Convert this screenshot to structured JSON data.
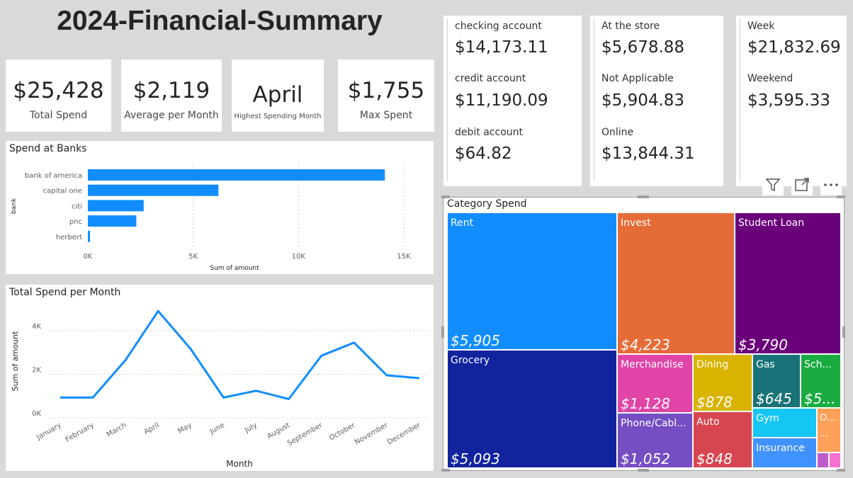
{
  "page_title": "2024-Financial-Summary",
  "kpis": [
    {
      "value": "$25,428",
      "label": "Total Spend"
    },
    {
      "value": "$2,119",
      "label": "Average per Month"
    },
    {
      "value": "April",
      "label": "Highest Spending Month"
    },
    {
      "value": "$1,755",
      "label": "Max Spent"
    }
  ],
  "multirow_cards": [
    {
      "rows": [
        {
          "label": "checking account",
          "value": "$14,173.11"
        },
        {
          "label": "credit account",
          "value": "$11,190.09"
        },
        {
          "label": "debit account",
          "value": "$64.82"
        }
      ]
    },
    {
      "rows": [
        {
          "label": "At the store",
          "value": "$5,678.88"
        },
        {
          "label": "Not Applicable",
          "value": "$5,904.83"
        },
        {
          "label": "Online",
          "value": "$13,844.31"
        }
      ]
    },
    {
      "rows": [
        {
          "label": "Week",
          "value": "$21,832.69"
        },
        {
          "label": "Weekend",
          "value": "$3,595.33"
        }
      ]
    }
  ],
  "visual_header": {
    "icons": [
      "filter-icon",
      "focus-mode-icon",
      "more-options-icon"
    ]
  },
  "chart_data": [
    {
      "type": "bar",
      "orientation": "horizontal",
      "title": "Spend at Banks",
      "xlabel": "Sum of amount",
      "ylabel": "bank",
      "categories": [
        "bank of america",
        "capital one",
        "citi",
        "pnc",
        "herbert"
      ],
      "values": [
        14100,
        6200,
        2650,
        2300,
        100
      ],
      "xlim": [
        0,
        15000
      ],
      "x_ticks": [
        0,
        5000,
        10000,
        15000
      ],
      "x_tick_labels": [
        "0K",
        "5K",
        "10K",
        "15K"
      ],
      "grid": true,
      "color": "#118DFF"
    },
    {
      "type": "line",
      "title": "Total Spend per Month",
      "xlabel": "Month",
      "ylabel": "Sum of amount",
      "categories": [
        "January",
        "February",
        "March",
        "April",
        "May",
        "June",
        "July",
        "August",
        "September",
        "October",
        "November",
        "December"
      ],
      "values": [
        930,
        930,
        2650,
        4900,
        3150,
        930,
        1240,
        860,
        2850,
        3450,
        1950,
        1820
      ],
      "ylim": [
        0,
        5200
      ],
      "y_ticks": [
        0,
        2000,
        4000
      ],
      "y_tick_labels": [
        "0K",
        "2K",
        "4K"
      ],
      "grid": true,
      "color": "#118DFF"
    },
    {
      "type": "treemap",
      "title": "Category Spend",
      "items": [
        {
          "label": "Rent",
          "value_label": "$5,905",
          "value": 5905,
          "color": "#118DFF"
        },
        {
          "label": "Grocery",
          "value_label": "$5,093",
          "value": 5093,
          "color": "#12239E"
        },
        {
          "label": "Invest",
          "value_label": "$4,223",
          "value": 4223,
          "color": "#E66C37"
        },
        {
          "label": "Student Loan",
          "value_label": "$3,790",
          "value": 3790,
          "color": "#6B007B"
        },
        {
          "label": "Merchandise",
          "value_label": "$1,128",
          "value": 1128,
          "color": "#E044A7"
        },
        {
          "label": "Phone/Cabl...",
          "value_label": "$1,052",
          "value": 1052,
          "color": "#744EC2"
        },
        {
          "label": "Dining",
          "value_label": "$878",
          "value": 878,
          "color": "#D9B300"
        },
        {
          "label": "Auto",
          "value_label": "$848",
          "value": 848,
          "color": "#D64550"
        },
        {
          "label": "Gas",
          "value_label": "$645",
          "value": 645,
          "color": "#197278"
        },
        {
          "label": "Sch...",
          "value_label": "$5...",
          "color": "#1AAB40"
        },
        {
          "label": "Gym",
          "value_label": "",
          "color": "#15C6F4"
        },
        {
          "label": "Insurance",
          "value_label": "",
          "color": "#4092FF"
        },
        {
          "label": "O...",
          "value_label": "...",
          "color": "#FFA058"
        },
        {
          "label": "",
          "value_label": "",
          "color": "#BE5DC9"
        },
        {
          "label": "",
          "value_label": "",
          "color": "#F472D0"
        }
      ]
    }
  ]
}
